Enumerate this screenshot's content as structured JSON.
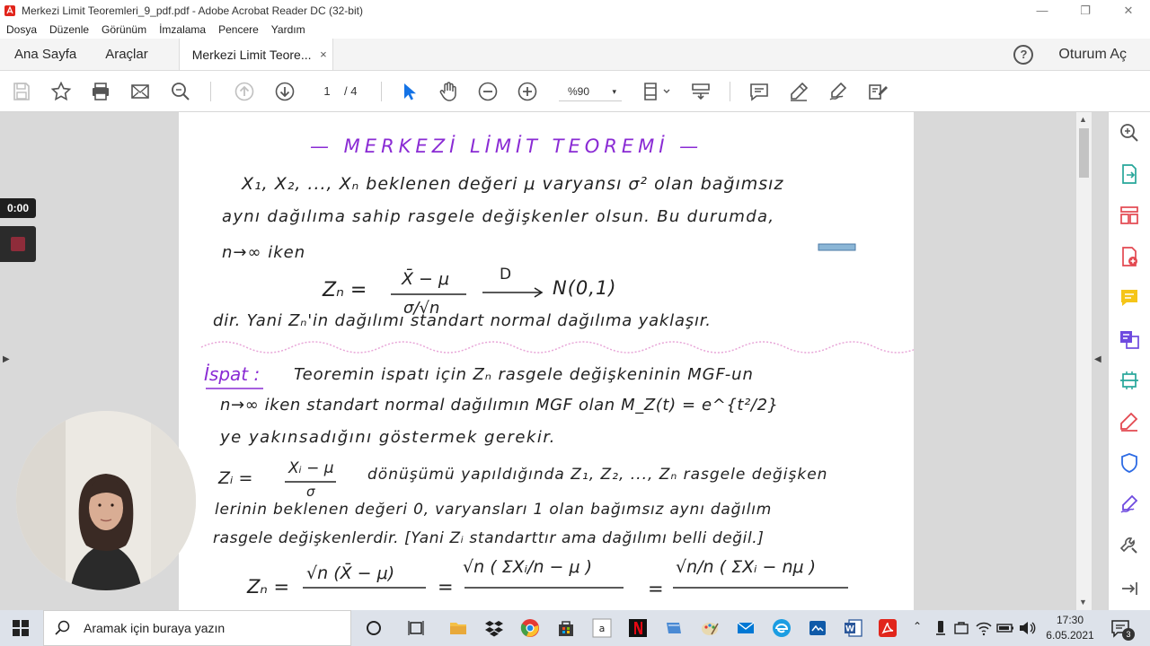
{
  "window": {
    "title": "Merkezi Limit Teoremleri_9_pdf.pdf - Adobe Acrobat Reader DC (32-bit)",
    "minimize": "—",
    "restore": "❐",
    "close": "✕"
  },
  "menu": [
    "Dosya",
    "Düzenle",
    "Görünüm",
    "İmzalama",
    "Pencere",
    "Yardım"
  ],
  "tabs": {
    "home": "Ana Sayfa",
    "tools": "Araçlar",
    "document": "Merkezi Limit Teore...",
    "close": "×",
    "help": "?",
    "signin": "Oturum Aç"
  },
  "toolbar": {
    "page_current": "1",
    "page_total": "/ 4",
    "zoom": "%90",
    "zoom_caret": "▾"
  },
  "overlay": {
    "timer": "0:00"
  },
  "document": {
    "title": "— MERKEZİ LİMİT TEOREMİ —",
    "line1": "X₁, X₂, ..., Xₙ  beklenen değeri μ  varyansı σ²  olan bağımsız",
    "line2": "aynı dağılıma sahip rasgele değişkenler olsun. Bu durumda,",
    "line3": "n→∞  iken",
    "formula1_left": "Zₙ =",
    "formula1_num": "X̄ − μ",
    "formula1_den": "σ/√n",
    "formula1_arrow_label": "D",
    "formula1_right": "N(0,1)",
    "line4": "dir. Yani Zₙ'in dağılımı  standart normal dağılıma yaklaşır.",
    "proof_label": "İspat :",
    "proof1": "Teoremin ispatı için Zₙ rasgele değişkeninin MGF-un",
    "proof2": "n→∞  iken  standart normal dağılımın  MGF olan  M_Z(t) = e^{t²/2}",
    "proof3": "ye yakınsadığını göstermek gerekir.",
    "trans_left": "Zᵢ =",
    "trans_num": "Xᵢ − μ",
    "trans_den": "σ",
    "trans_text": "dönüşümü yapıldığında  Z₁, Z₂, ..., Zₙ  rasgele değişken",
    "line5": "lerinin beklenen değeri 0, varyansları 1 olan bağımsız aynı dağılım",
    "line6": "rasgele değişkenlerdir. [Yani Zᵢ standarttır ama dağılımı belli değil.]",
    "formula2_left": "Zₙ =",
    "formula2_a_num": "√n (X̄ − μ)",
    "formula2_eq": "=",
    "formula2_b_num": "√n ( ΣXᵢ/n − μ )",
    "formula2_eq2": "=",
    "formula2_c_num": "√n/n ( ΣXᵢ − nμ )"
  },
  "taskbar": {
    "search_placeholder": "Aramak için buraya yazın",
    "time": "17:30",
    "date": "6.05.2021",
    "notifications": "3"
  },
  "colors": {
    "ink": "#222222",
    "purple": "#8a2bd4",
    "pink_wave": "#e8a6d8",
    "acrobat_red": "#e1251b",
    "accent_blue": "#1473e6"
  }
}
